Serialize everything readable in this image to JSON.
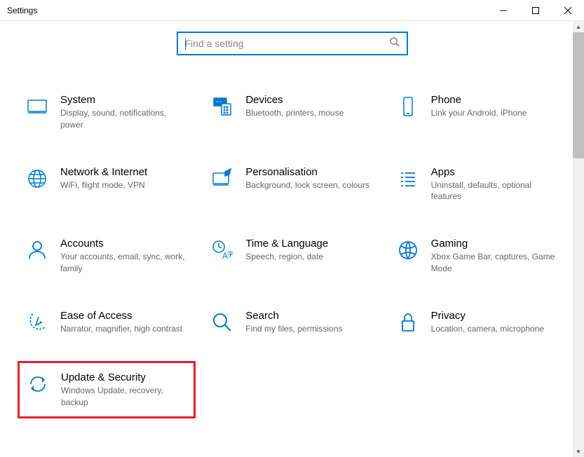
{
  "window": {
    "title": "Settings"
  },
  "search": {
    "placeholder": "Find a setting",
    "value": ""
  },
  "tiles": [
    {
      "title": "System",
      "desc": "Display, sound, notifications, power"
    },
    {
      "title": "Devices",
      "desc": "Bluetooth, printers, mouse"
    },
    {
      "title": "Phone",
      "desc": "Link your Android, iPhone"
    },
    {
      "title": "Network & Internet",
      "desc": "WiFi, flight mode, VPN"
    },
    {
      "title": "Personalisation",
      "desc": "Background, lock screen, colours"
    },
    {
      "title": "Apps",
      "desc": "Uninstall, defaults, optional features"
    },
    {
      "title": "Accounts",
      "desc": "Your accounts, email, sync, work, family"
    },
    {
      "title": "Time & Language",
      "desc": "Speech, region, date"
    },
    {
      "title": "Gaming",
      "desc": "Xbox Game Bar, captures, Game Mode"
    },
    {
      "title": "Ease of Access",
      "desc": "Narrator, magnifier, high contrast"
    },
    {
      "title": "Search",
      "desc": "Find my files, permissions"
    },
    {
      "title": "Privacy",
      "desc": "Location, camera, microphone"
    },
    {
      "title": "Update & Security",
      "desc": "Windows Update, recovery, backup"
    }
  ]
}
